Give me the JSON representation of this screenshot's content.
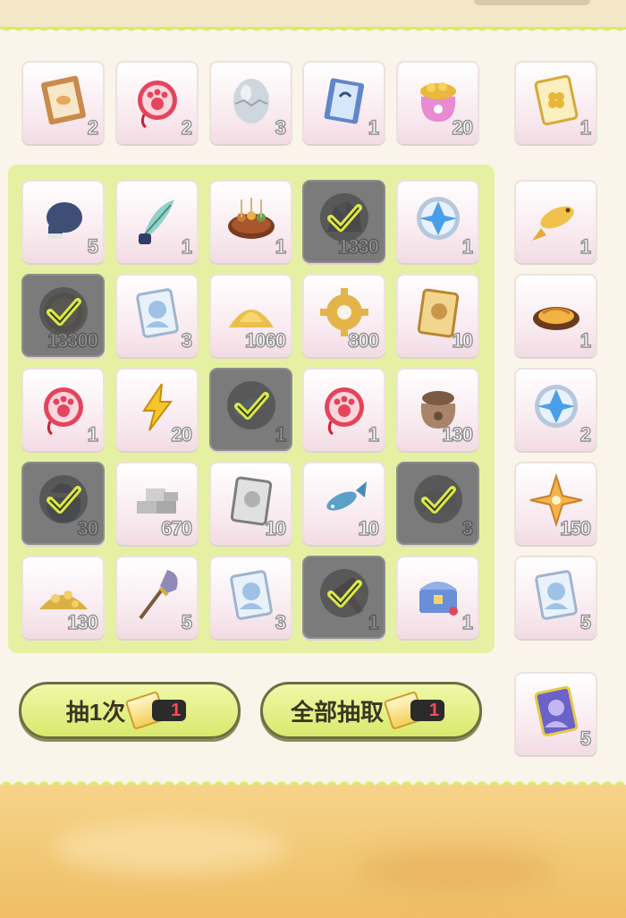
{
  "colors": {
    "accent": "#d8ec6a",
    "panel": "#e6f0a2",
    "claimed": "#7b7b7b",
    "ticket_count": "#ff4a5a"
  },
  "top_row": [
    {
      "icon": "recipe-book-icon",
      "qty": "2"
    },
    {
      "icon": "paw-amulet-icon",
      "qty": "2"
    },
    {
      "icon": "egg-icon",
      "qty": "3"
    },
    {
      "icon": "blue-book-icon",
      "qty": "1"
    },
    {
      "icon": "coin-bag-icon",
      "qty": "20"
    }
  ],
  "grid": [
    {
      "icon": "boxing-glove-icon",
      "qty": "5",
      "claimed": false
    },
    {
      "icon": "feather-quill-icon",
      "qty": "1",
      "claimed": false
    },
    {
      "icon": "skewer-platter-icon",
      "qty": "1",
      "claimed": false
    },
    {
      "icon": "ore-icon",
      "qty": "1330",
      "claimed": true
    },
    {
      "icon": "crystal-medal-icon",
      "qty": "1",
      "claimed": false
    },
    {
      "icon": "token-icon",
      "qty": "13300",
      "claimed": true
    },
    {
      "icon": "character-card-icon",
      "qty": "3",
      "claimed": false
    },
    {
      "icon": "sand-pile-icon",
      "qty": "1060",
      "claimed": false
    },
    {
      "icon": "gear-icon",
      "qty": "800",
      "claimed": false
    },
    {
      "icon": "gold-card-icon",
      "qty": "10",
      "claimed": false
    },
    {
      "icon": "paw-amulet-icon",
      "qty": "1",
      "claimed": false
    },
    {
      "icon": "lightning-icon",
      "qty": "20",
      "claimed": false
    },
    {
      "icon": "fish-icon",
      "qty": "1",
      "claimed": true
    },
    {
      "icon": "paw-amulet-icon",
      "qty": "1",
      "claimed": false
    },
    {
      "icon": "sack-icon",
      "qty": "130",
      "claimed": false
    },
    {
      "icon": "ore-bag-icon",
      "qty": "30",
      "claimed": true
    },
    {
      "icon": "stone-bricks-icon",
      "qty": "670",
      "claimed": false
    },
    {
      "icon": "silver-card-icon",
      "qty": "10",
      "claimed": false
    },
    {
      "icon": "fish-icon",
      "qty": "10",
      "claimed": false
    },
    {
      "icon": "rock-icon",
      "qty": "3",
      "claimed": true
    },
    {
      "icon": "gold-nuggets-icon",
      "qty": "130",
      "claimed": false
    },
    {
      "icon": "shovel-icon",
      "qty": "5",
      "claimed": false
    },
    {
      "icon": "character-card-icon",
      "qty": "3",
      "claimed": false
    },
    {
      "icon": "hammer-icon",
      "qty": "1",
      "claimed": true
    },
    {
      "icon": "treasure-chest-icon",
      "qty": "1",
      "claimed": false
    }
  ],
  "side_column": [
    {
      "icon": "clover-card-icon",
      "qty": "1"
    },
    {
      "icon": "golden-fish-icon",
      "qty": "1"
    },
    {
      "icon": "food-dish-icon",
      "qty": "1"
    },
    {
      "icon": "crystal-medal-icon",
      "qty": "2"
    },
    {
      "icon": "star-crystal-icon",
      "qty": "150"
    },
    {
      "icon": "character-card-icon",
      "qty": "5"
    },
    {
      "icon": "rainbow-card-icon",
      "qty": "5"
    }
  ],
  "buttons": {
    "draw_once_label": "抽1次",
    "draw_once_cost": "1",
    "draw_all_label": "全部抽取",
    "draw_all_cost": "1"
  }
}
